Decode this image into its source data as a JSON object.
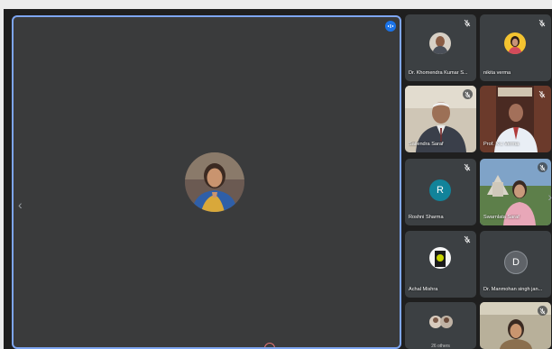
{
  "main": {
    "participant_avatar": "presenter-photo-avatar"
  },
  "participants": [
    {
      "name": "Dr. Khomendra Kumar S...",
      "muted": true
    },
    {
      "name": "nikita verma",
      "muted": true
    },
    {
      "name": "Sailendra Saraf",
      "muted": true
    },
    {
      "name": "Prof. K L Verma",
      "muted": true
    },
    {
      "name": "Roshni Sharma",
      "avatar_letter": "R",
      "muted": true
    },
    {
      "name": "Swarnlata Saraf",
      "muted": true
    },
    {
      "name": "Achal Mishra",
      "muted": true
    },
    {
      "name": "Dr. Manmohan singh jan...",
      "avatar_letter": "D",
      "muted": false
    },
    {
      "others_label": "26 others"
    },
    {
      "name": ""
    }
  ],
  "colors": {
    "speaking_border": "#7ea6f2",
    "roshni_avatar": "#12839a",
    "manmohan_avatar": "#5f6368"
  }
}
